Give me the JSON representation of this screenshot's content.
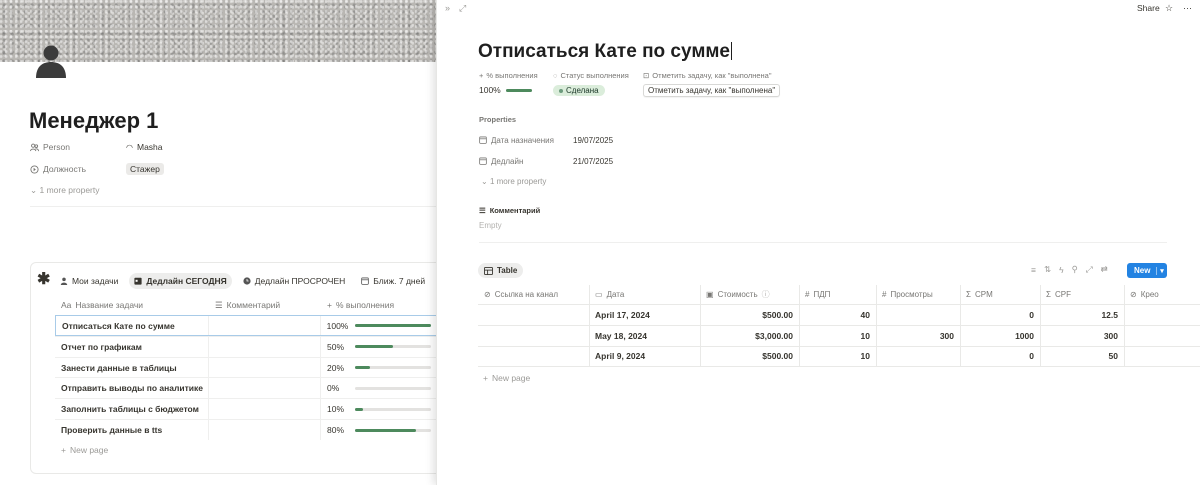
{
  "left_page": {
    "title": "Менеджер 1",
    "properties": [
      {
        "key": "Person",
        "value": "Masha",
        "icon": "people-icon"
      },
      {
        "key": "Должность",
        "value": "Стажер",
        "icon": "status-circle-icon"
      }
    ],
    "more_property": "1 more property",
    "database": {
      "views": [
        {
          "label": "Мои задачи",
          "icon": "person-icon",
          "active": false
        },
        {
          "label": "Дедлайн СЕГОДНЯ",
          "icon": "calendar-icon",
          "active": true
        },
        {
          "label": "Дедлайн ПРОСРОЧЕН",
          "icon": "clock-icon",
          "active": false
        },
        {
          "label": "Ближ. 7 дней",
          "icon": "calendar-icon",
          "active": false
        }
      ],
      "columns": [
        {
          "label": "Название задачи",
          "icon": "text-icon"
        },
        {
          "label": "Комментарий",
          "icon": "lines-icon"
        },
        {
          "label": "% выполнения",
          "icon": "plus-icon"
        }
      ],
      "rows": [
        {
          "name": "Отписаться Кате по сумме",
          "pct_label": "100%",
          "pct": 1.0
        },
        {
          "name": "Отчет по графикам",
          "pct_label": "50%",
          "pct": 0.5
        },
        {
          "name": "Занести данные в таблицы",
          "pct_label": "20%",
          "pct": 0.2
        },
        {
          "name": "Отправить выводы по аналитике",
          "pct_label": "0%",
          "pct": 0.0
        },
        {
          "name": "Заполнить таблицы с бюджетом",
          "pct_label": "10%",
          "pct": 0.1
        },
        {
          "name": "Проверить данные в tts",
          "pct_label": "80%",
          "pct": 0.8
        }
      ],
      "new_page": "New page"
    }
  },
  "peek": {
    "share_label": "Share",
    "title": "Отписаться Кате по сумме",
    "top_props": [
      {
        "label": "% выполнения",
        "icon": "plus-icon"
      },
      {
        "label": "Статус выполнения",
        "icon": "status-circle-icon"
      },
      {
        "label": "Отметить задачу, как \"выполнена\"",
        "icon": "button-icon"
      }
    ],
    "pct_value": "100%",
    "pct": 1.0,
    "status_value": "Сделана",
    "mark_button": "Отметить задачу, как \"выполнена\"",
    "properties_label": "Properties",
    "properties": [
      {
        "key": "Дата назначения",
        "value": "19/07/2025",
        "icon": "calendar-icon"
      },
      {
        "key": "Дедлайн",
        "value": "21/07/2025",
        "icon": "calendar-icon"
      }
    ],
    "more_property": "1 more property",
    "comment_label": "Комментарий",
    "comment_empty": "Empty",
    "table": {
      "tab_label": "Table",
      "new_label": "New",
      "columns": [
        {
          "label": "Ссылка на канал",
          "icon": "link-icon"
        },
        {
          "label": "Дата",
          "icon": "calendar-icon"
        },
        {
          "label": "Стоимость",
          "icon": "money-icon",
          "info": "ⓘ"
        },
        {
          "label": "ПДП",
          "icon": "hash-icon"
        },
        {
          "label": "Просмотры",
          "icon": "hash-icon"
        },
        {
          "label": "CPM",
          "icon": "sigma-icon"
        },
        {
          "label": "CPF",
          "icon": "sigma-icon"
        },
        {
          "label": "Крео",
          "icon": "link-icon"
        }
      ],
      "rows": [
        {
          "link": "",
          "date": "April 17, 2024",
          "cost": "$500.00",
          "pdp": "40",
          "views": "",
          "cpm": "0",
          "cpf": "12.5",
          "kreo": ""
        },
        {
          "link": "",
          "date": "May 18, 2024",
          "cost": "$3,000.00",
          "pdp": "10",
          "views": "300",
          "cpm": "1000",
          "cpf": "300",
          "kreo": ""
        },
        {
          "link": "",
          "date": "April 9, 2024",
          "cost": "$500.00",
          "pdp": "10",
          "views": "",
          "cpm": "0",
          "cpf": "50",
          "kreo": ""
        }
      ],
      "new_page": "New page"
    }
  }
}
